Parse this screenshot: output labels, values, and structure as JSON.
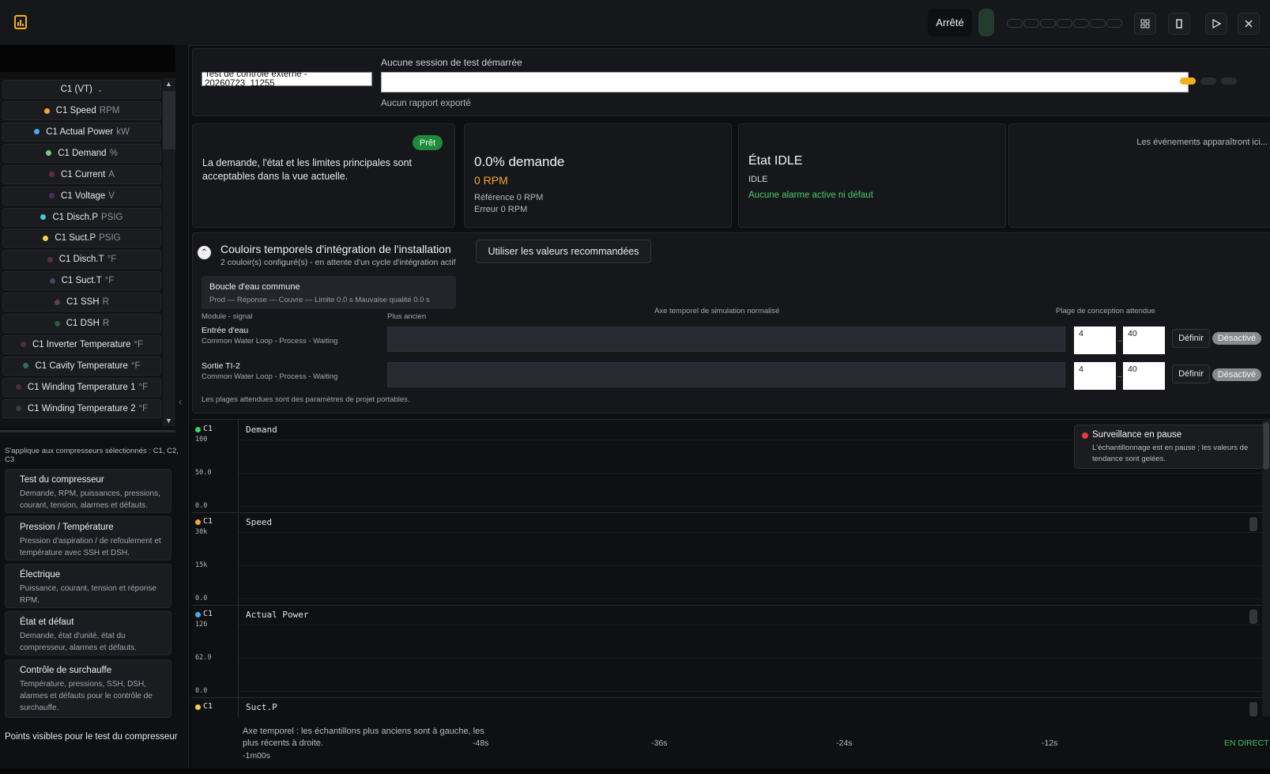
{
  "topbar": {
    "status_label": "Arrêté",
    "icons": [
      "grid-icon",
      "stop-icon",
      "play-icon",
      "close-icon"
    ]
  },
  "sidebar": {
    "group_label": "C1 (VT)",
    "signals": [
      {
        "label": "C1 Speed",
        "unit": "RPM",
        "color": "#f2a531"
      },
      {
        "label": "C1 Actual Power",
        "unit": "kW",
        "color": "#4aa8e8"
      },
      {
        "label": "C1 Demand",
        "unit": "%",
        "color": "#6fcf86"
      },
      {
        "label": "C1 Current",
        "unit": "A",
        "color": "#5e2f36"
      },
      {
        "label": "C1 Voltage",
        "unit": "V",
        "color": "#4b2d57"
      },
      {
        "label": "C1 Disch.P",
        "unit": "PSIG",
        "color": "#43c7e6"
      },
      {
        "label": "C1 Suct.P",
        "unit": "PSIG",
        "color": "#f2d24a"
      },
      {
        "label": "C1 Disch.T",
        "unit": "°F",
        "color": "#5b3140"
      },
      {
        "label": "C1 Suct.T",
        "unit": "°F",
        "color": "#3c4a63"
      },
      {
        "label": "C1 SSH",
        "unit": "R",
        "color": "#5c3f4e"
      },
      {
        "label": "C1 DSH",
        "unit": "R",
        "color": "#2f5a3e"
      },
      {
        "label": "C1 Inverter Temperature",
        "unit": "°F",
        "color": "#4a3437"
      },
      {
        "label": "C1 Cavity Temperature",
        "unit": "°F",
        "color": "#2f6e6a"
      },
      {
        "label": "C1 Winding Temperature 1",
        "unit": "°F",
        "color": "#4a2e33"
      },
      {
        "label": "C1 Winding Temperature 2",
        "unit": "°F",
        "color": "#3a3d40"
      }
    ],
    "applies_text": "S'applique aux compresseurs sélectionnés : C1, C2, C3",
    "cards": [
      {
        "title": "Test du compresseur",
        "desc": "Demande, RPM, puissances, pressions, courant, tension, alarmes et défauts."
      },
      {
        "title": "Pression / Température",
        "desc": "Pression d'aspiration / de refoulement et température avec SSH et DSH."
      },
      {
        "title": "Électrique",
        "desc": "Puissance, courant, tension et réponse RPM."
      },
      {
        "title": "État et défaut",
        "desc": "Demande, état d'unité, état du compresseur, alarmes et défauts."
      },
      {
        "title": "Contrôle de surchauffe",
        "desc": "Température, pressions, SSH, DSH, alarmes et défauts pour le contrôle de surchauffe."
      }
    ],
    "visible_points_label": "Points visibles pour le test du compresseur"
  },
  "session": {
    "name_value": "Test de contrôle externe - 20260723_11255",
    "status": "Aucune session de test démarrée",
    "report_status": "Aucun rapport exporté",
    "pill_colors": [
      "#f2b01e",
      "#2a2c31",
      "#2a2c31"
    ]
  },
  "cards": {
    "ready_badge": "Prêt",
    "ready_text": "La demande, l'état et les limites principales sont acceptables dans la vue actuelle.",
    "demand_title": "0.0% demande",
    "demand_rpm": "0 RPM",
    "demand_ref": "Référence 0 RPM",
    "demand_err": "Erreur 0 RPM",
    "state_title": "État IDLE",
    "state_sub": "IDLE",
    "state_alarm": "Aucune alarme active ni défaut",
    "events_empty": "Les événements apparaîtront ici..."
  },
  "corridors": {
    "title": "Couloirs temporels d'intégration de l'installation",
    "subtitle": "2 couloir(s) configuré(s) - en attente d'un cycle d'intégration actif",
    "reco_button": "Utiliser les valeurs recommandées",
    "loop_name": "Boucle d'eau commune",
    "loop_chain": "Prod — Réponse — Couvre — Limite 0.0 s   Mauvaise qualité 0.0 s",
    "hdr_module": "Module - signal",
    "hdr_oldest": "Plus ancien",
    "hdr_axis": "Axe temporel de simulation normalisé",
    "hdr_range": "Plage de conception attendue",
    "rows": [
      {
        "label": "Entrée d'eau",
        "sub": "Common Water Loop - Process - Waiting",
        "min": "4",
        "max": "40",
        "define": "Définir",
        "status": "Désactivé"
      },
      {
        "label": "Sortie TI-2",
        "sub": "Common Water Loop - Process - Waiting",
        "min": "4",
        "max": "40",
        "define": "Définir",
        "status": "Désactivé"
      }
    ],
    "note": "Les plages attendues sont des paramètres de projet portables."
  },
  "charts": [
    {
      "series": "C1",
      "name": "Demand",
      "color": "#3ecf6a",
      "ticks": [
        "100",
        "50.0",
        "0.0"
      ]
    },
    {
      "series": "C1",
      "name": "Speed",
      "color": "#f2a531",
      "ticks": [
        "30k",
        "15k",
        "0.0"
      ]
    },
    {
      "series": "C1",
      "name": "Actual Power",
      "color": "#4aa8e8",
      "ticks": [
        "126",
        "62.9",
        "0.0"
      ]
    },
    {
      "series": "C1",
      "name": "Suct.P",
      "color": "#f2d24a",
      "ticks": []
    }
  ],
  "toast": {
    "title": "Surveillance en pause",
    "text": "L'échantillonnage est en pause ; les valeurs de tendance sont gelées."
  },
  "time_axis": {
    "note": "Axe temporel : les échantillons plus anciens sont à gauche, les plus récents à droite.",
    "start": "-1m00s",
    "ticks": [
      "-48s",
      "-36s",
      "-24s",
      "-12s"
    ],
    "live": "EN DIRECT"
  }
}
